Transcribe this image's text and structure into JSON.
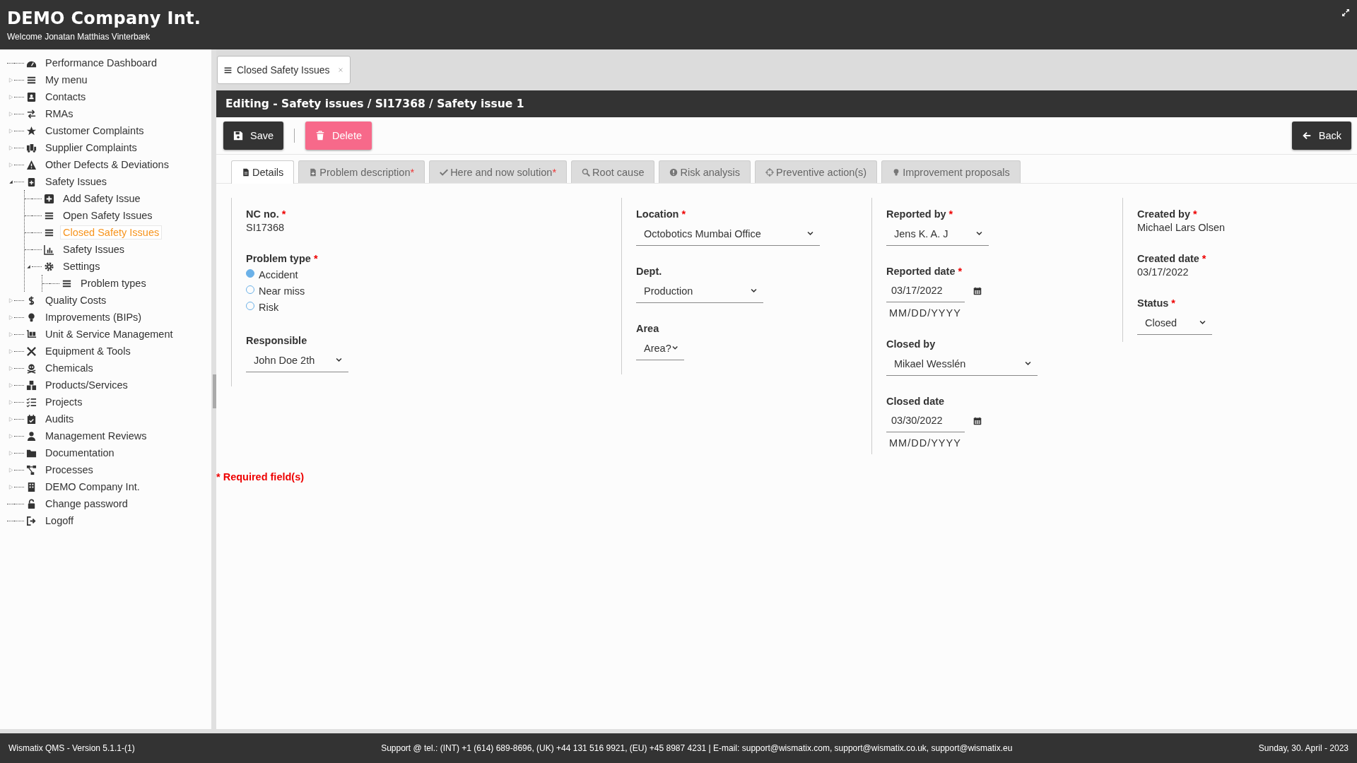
{
  "header": {
    "title": "DEMO Company Int.",
    "welcome": "Welcome Jonatan Matthias Vinterbæk"
  },
  "sidebar": {
    "items": [
      {
        "label": "Performance Dashboard",
        "kind": "leaf",
        "selected": false
      },
      {
        "label": "My menu",
        "kind": "folder",
        "expanded": false,
        "selected": false
      },
      {
        "label": "Contacts",
        "kind": "folder",
        "expanded": false,
        "selected": false
      },
      {
        "label": "RMAs",
        "kind": "folder",
        "expanded": false,
        "selected": false
      },
      {
        "label": "Customer Complaints",
        "kind": "folder",
        "expanded": false,
        "selected": false
      },
      {
        "label": "Supplier Complaints",
        "kind": "folder",
        "expanded": false,
        "selected": false
      },
      {
        "label": "Other Defects & Deviations",
        "kind": "folder",
        "expanded": false,
        "selected": false
      },
      {
        "label": "Safety Issues",
        "kind": "folder",
        "expanded": true,
        "selected": false,
        "children": [
          {
            "label": "Add Safety Issue",
            "kind": "leaf",
            "selected": false
          },
          {
            "label": "Open Safety Issues",
            "kind": "leaf",
            "selected": false
          },
          {
            "label": "Closed Safety Issues",
            "kind": "leaf",
            "selected": true
          },
          {
            "label": "Safety Issues",
            "kind": "leaf",
            "selected": false
          },
          {
            "label": "Settings",
            "kind": "folder",
            "expanded": true,
            "selected": false,
            "children": [
              {
                "label": "Problem types",
                "kind": "leaf",
                "selected": false
              }
            ]
          }
        ]
      },
      {
        "label": "Quality Costs",
        "kind": "folder",
        "expanded": false,
        "selected": false
      },
      {
        "label": "Improvements (BIPs)",
        "kind": "folder",
        "expanded": false,
        "selected": false
      },
      {
        "label": "Unit & Service Management",
        "kind": "folder",
        "expanded": false,
        "selected": false
      },
      {
        "label": "Equipment & Tools",
        "kind": "folder",
        "expanded": false,
        "selected": false
      },
      {
        "label": "Chemicals",
        "kind": "folder",
        "expanded": false,
        "selected": false
      },
      {
        "label": "Products/Services",
        "kind": "folder",
        "expanded": false,
        "selected": false
      },
      {
        "label": "Projects",
        "kind": "folder",
        "expanded": false,
        "selected": false
      },
      {
        "label": "Audits",
        "kind": "folder",
        "expanded": false,
        "selected": false
      },
      {
        "label": "Management Reviews",
        "kind": "folder",
        "expanded": false,
        "selected": false
      },
      {
        "label": "Documentation",
        "kind": "folder",
        "expanded": false,
        "selected": false
      },
      {
        "label": "Processes",
        "kind": "folder",
        "expanded": false,
        "selected": false
      },
      {
        "label": "DEMO Company Int.",
        "kind": "folder",
        "expanded": false,
        "selected": false
      },
      {
        "label": "Change password",
        "kind": "leaf",
        "selected": false
      },
      {
        "label": "Logoff",
        "kind": "leaf",
        "selected": false
      }
    ]
  },
  "open_tabs": [
    {
      "label": "Closed Safety Issues",
      "selected": true
    }
  ],
  "editor": {
    "title": "Editing - Safety issues / SI17368 / Safety issue 1",
    "buttons": [
      {
        "label": "Save",
        "kind": "save"
      },
      {
        "label": "Delete",
        "kind": "delete"
      },
      {
        "label": "Back",
        "kind": "back"
      }
    ],
    "tabs": [
      {
        "label": "Details",
        "selected": true
      },
      {
        "label": "Problem description",
        "required_mark": "*",
        "selected": false
      },
      {
        "label": "Here and now solution",
        "required_mark": "*",
        "selected": false
      },
      {
        "label": "Root cause",
        "selected": false
      },
      {
        "label": "Risk analysis",
        "selected": false
      },
      {
        "label": "Preventive action(s)",
        "selected": false
      },
      {
        "label": "Improvement proposals",
        "selected": false
      }
    ],
    "columns": [
      [
        {
          "kind": "text",
          "label": "NC no.",
          "required_mark": "*",
          "value": "SI17368"
        },
        {
          "kind": "radio",
          "label": "Problem type",
          "required_mark": "*",
          "options": [
            {
              "label": "Accident",
              "selected": true
            },
            {
              "label": "Near miss",
              "selected": false
            },
            {
              "label": "Risk",
              "selected": false
            }
          ]
        },
        {
          "kind": "select",
          "label": "Responsible",
          "value": "John Doe 2th"
        }
      ],
      [
        {
          "kind": "select",
          "label": "Location",
          "required_mark": "*",
          "value": "Octobotics Mumbai Office"
        },
        {
          "kind": "select",
          "label": "Dept.",
          "value": "Production"
        },
        {
          "kind": "select",
          "label": "Area",
          "value": "Area?"
        }
      ],
      [
        {
          "kind": "select",
          "label": "Reported by",
          "required_mark": "*",
          "value": "Jens K. A. J"
        },
        {
          "kind": "date",
          "label": "Reported date",
          "required_mark": "*",
          "value": "03/17/2022",
          "format_hint": "MM/DD/YYYY"
        },
        {
          "kind": "select",
          "label": "Closed by",
          "value": "Mikael Wesslén"
        },
        {
          "kind": "date",
          "label": "Closed date",
          "value": "03/30/2022",
          "format_hint": "MM/DD/YYYY"
        }
      ],
      [
        {
          "kind": "text",
          "label": "Created by",
          "required_mark": "*",
          "value": "Michael Lars Olsen"
        },
        {
          "kind": "text",
          "label": "Created date",
          "required_mark": "*",
          "value": "03/17/2022"
        },
        {
          "kind": "select",
          "label": "Status",
          "required_mark": "*",
          "value": "Closed"
        }
      ]
    ],
    "required_note": "* Required field(s)"
  },
  "footer": {
    "version": "Wismatix QMS - Version 5.1.1-(1)",
    "support": "Support @ tel.: (INT) +1 (614) 689-8696, (UK) +44 131 516 9921, (EU) +45 8987 4231 | E-mail: support@wismatix.com, support@wismatix.co.uk, support@wismatix.eu",
    "date": "Sunday, 30. April - 2023"
  }
}
